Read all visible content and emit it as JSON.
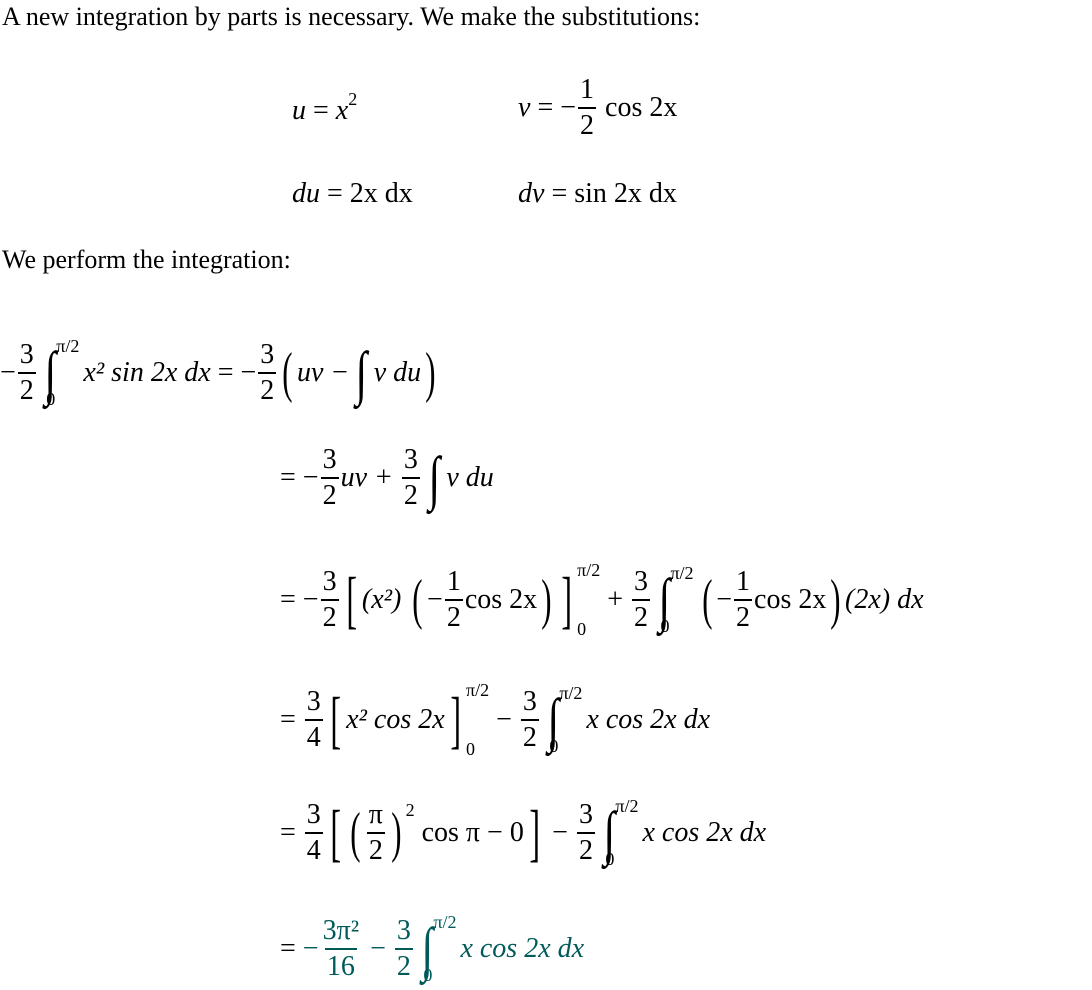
{
  "paragraphs": {
    "intro": "A new integration by parts is necessary. We make the substitutions:",
    "perform": "We perform the integration:"
  },
  "substitutions": {
    "u_lhs": "u",
    "u_rhs_base": "x",
    "u_rhs_exp": "2",
    "v_lhs": "v",
    "v_coef_num": "1",
    "v_coef_den": "2",
    "v_rest": "cos 2x",
    "du_lhs": "du",
    "du_rhs": "2x dx",
    "dv_lhs": "dv",
    "dv_rhs": "sin 2x dx"
  },
  "derivation": {
    "line1_lhs": {
      "coef_num": "3",
      "coef_den": "2",
      "upper": "π/2",
      "lower": "0",
      "integrand": "x² sin 2x dx"
    },
    "line1_rhs": {
      "coef_num": "3",
      "coef_den": "2",
      "inner_a": "uv −",
      "inner_b": "v du"
    },
    "line2": {
      "coef1_num": "3",
      "coef1_den": "2",
      "term1": "uv +",
      "coef2_num": "3",
      "coef2_den": "2",
      "term2": "v du"
    },
    "line3": {
      "coef_num": "3",
      "coef_den": "2",
      "x2": "(x²)",
      "half_num": "1",
      "half_den": "2",
      "cos": "cos 2x",
      "upper": "π/2",
      "lower": "0",
      "coef2_num": "3",
      "coef2_den": "2",
      "tail": "(2x) dx"
    },
    "line4": {
      "coef_num": "3",
      "coef_den": "4",
      "inner": "x² cos 2x",
      "upper": "π/2",
      "lower": "0",
      "coef2_num": "3",
      "coef2_den": "2",
      "integrand": "x cos 2x dx"
    },
    "line5": {
      "coef_num": "3",
      "coef_den": "4",
      "pi_num": "π",
      "pi_den": "2",
      "exp": "2",
      "rest": "cos π − 0",
      "coef2_num": "3",
      "coef2_den": "2",
      "upper": "π/2",
      "lower": "0",
      "integrand": "x cos 2x dx"
    },
    "line6": {
      "res_num": "3π²",
      "res_den": "16",
      "coef2_num": "3",
      "coef2_den": "2",
      "upper": "π/2",
      "lower": "0",
      "integrand": "x cos 2x dx",
      "color": "#005a5a"
    }
  }
}
